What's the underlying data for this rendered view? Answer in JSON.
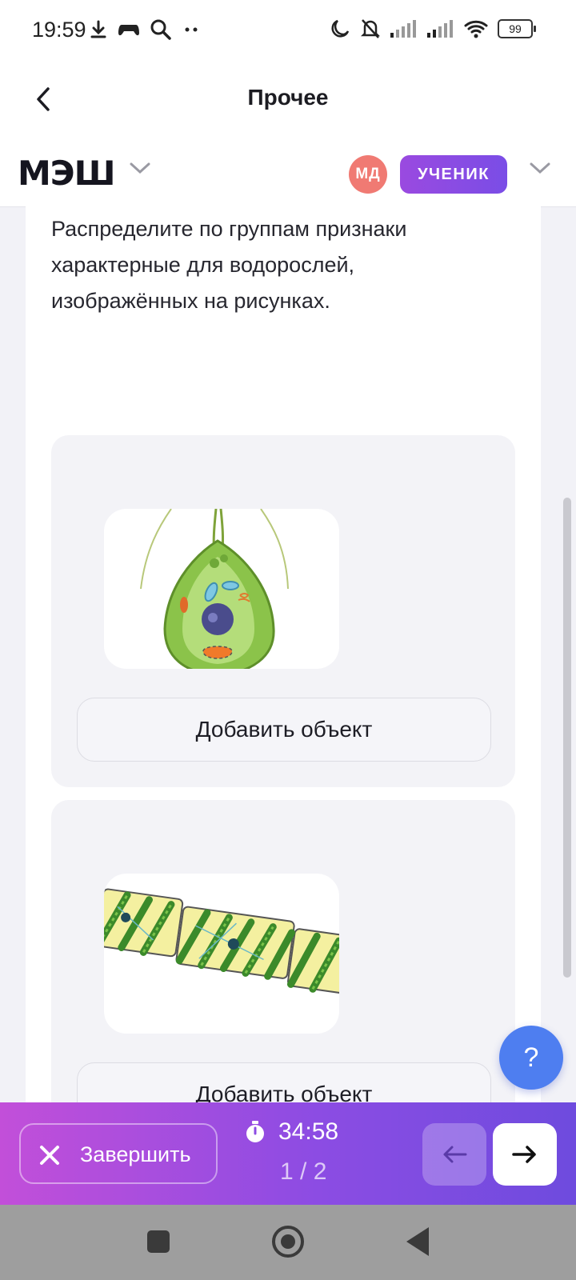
{
  "status_bar": {
    "time": "19:59",
    "battery": "99"
  },
  "title_bar": {
    "title": "Прочее"
  },
  "app_header": {
    "logo": "МЭШ",
    "avatar_initials": "МД",
    "role": "УЧЕНИК"
  },
  "task": {
    "question": "Распределите по группам признаки характерные для водорослей, изображённых на рисунках.",
    "groups": [
      {
        "add_label": "Добавить объект"
      },
      {
        "add_label": "Добавить объект"
      }
    ]
  },
  "help_button": {
    "label": "?"
  },
  "bottom_bar": {
    "finish_label": "Завершить",
    "timer": "34:58",
    "counter": "1 / 2"
  },
  "colors": {
    "accent": "#8c4ce3",
    "help": "#4e7ef0",
    "avatar": "#f07a73"
  }
}
